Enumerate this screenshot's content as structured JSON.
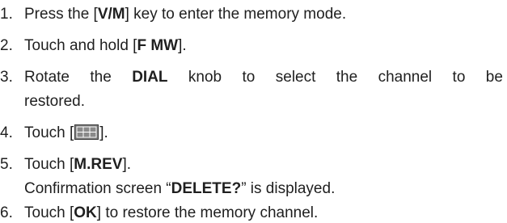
{
  "steps": [
    {
      "number": "1.",
      "pre": "Press the [",
      "key": "V/M",
      "post": "] key to enter the memory mode."
    },
    {
      "number": "2.",
      "pre": "Touch and hold [",
      "key": "F MW",
      "post": "]."
    },
    {
      "number": "3.",
      "words": [
        "Rotate",
        "the"
      ],
      "key": "DIAL",
      "words_after": [
        "knob",
        "to",
        "select",
        "the",
        "channel",
        "to",
        "be"
      ],
      "continuation": "restored."
    },
    {
      "number": "4.",
      "pre": "Touch [",
      "icon": "grid-menu-icon",
      "post": "]."
    },
    {
      "number": "5.",
      "pre": "Touch [",
      "key": "M.REV",
      "post": "].",
      "note_pre": "Confirmation screen “",
      "note_key": "DELETE?",
      "note_post": "” is displayed."
    },
    {
      "number": "6.",
      "pre": "Touch [",
      "key": "OK",
      "post": "] to restore the memory channel."
    }
  ],
  "colors": {
    "text": "#1f1f1f",
    "icon_fill": "#7a7a7a",
    "icon_border": "#3a3a3a"
  }
}
